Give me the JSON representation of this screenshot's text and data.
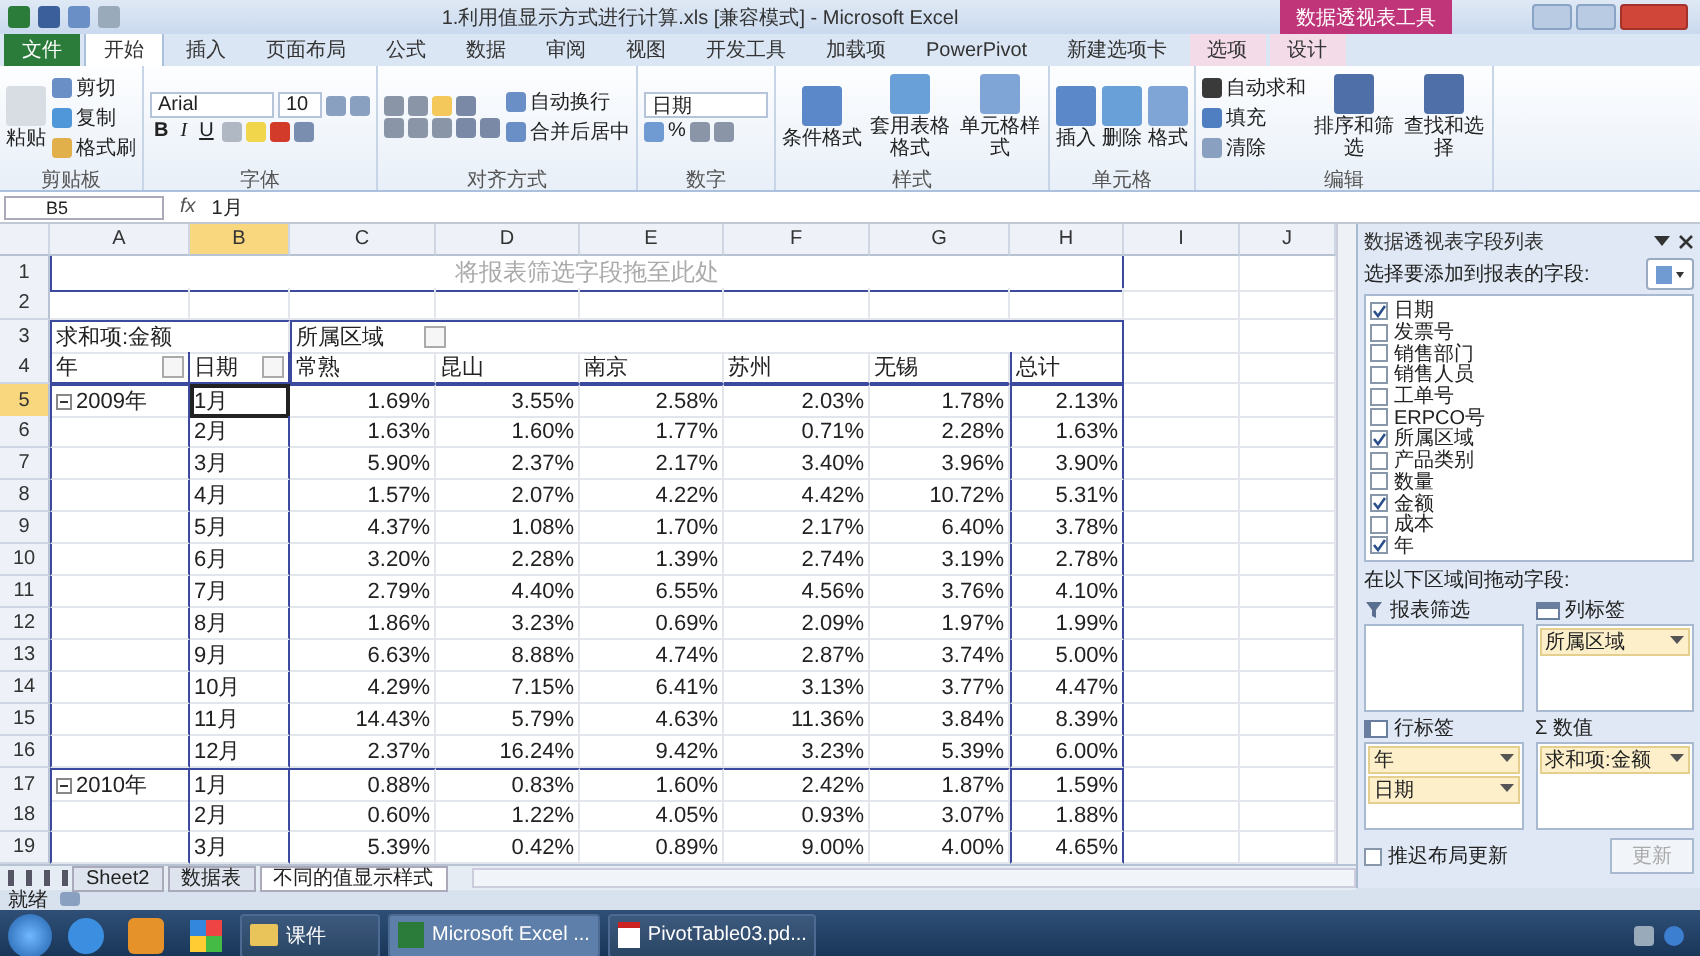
{
  "title_bar": {
    "title": "1.利用值显示方式进行计算.xls  [兼容模式] - Microsoft Excel",
    "context_label": "数据透视表工具"
  },
  "ribbon_tabs": [
    {
      "label": "文件",
      "kind": "file",
      "selected": false
    },
    {
      "label": "开始",
      "kind": "normal",
      "selected": true
    },
    {
      "label": "插入",
      "kind": "normal",
      "selected": false
    },
    {
      "label": "页面布局",
      "kind": "normal",
      "selected": false
    },
    {
      "label": "公式",
      "kind": "normal",
      "selected": false
    },
    {
      "label": "数据",
      "kind": "normal",
      "selected": false
    },
    {
      "label": "审阅",
      "kind": "normal",
      "selected": false
    },
    {
      "label": "视图",
      "kind": "normal",
      "selected": false
    },
    {
      "label": "开发工具",
      "kind": "normal",
      "selected": false
    },
    {
      "label": "加载项",
      "kind": "normal",
      "selected": false
    },
    {
      "label": "PowerPivot",
      "kind": "normal",
      "selected": false
    },
    {
      "label": "新建选项卡",
      "kind": "normal",
      "selected": false
    },
    {
      "label": "选项",
      "kind": "context",
      "selected": false
    },
    {
      "label": "设计",
      "kind": "context",
      "selected": false
    }
  ],
  "ribbon_groups": [
    {
      "label": "剪贴板",
      "kind": "clipboard",
      "big": "粘贴",
      "items": [
        "剪切",
        "复制",
        "格式刷"
      ]
    },
    {
      "label": "字体",
      "kind": "font",
      "font": "Arial",
      "size": "10",
      "style_buttons": [
        "B",
        "I",
        "U"
      ]
    },
    {
      "label": "对齐方式",
      "kind": "align",
      "items": [
        "自动换行",
        "合并后居中"
      ]
    },
    {
      "label": "数字",
      "kind": "number",
      "format": "日期",
      "items": [
        "%"
      ]
    },
    {
      "label": "样式",
      "kind": "large",
      "items": [
        "条件格式",
        "套用表格格式",
        "单元格样式"
      ]
    },
    {
      "label": "单元格",
      "kind": "large",
      "items": [
        "插入",
        "删除",
        "格式"
      ]
    },
    {
      "label": "编辑",
      "kind": "editing",
      "items": [
        "自动求和",
        "填充",
        "清除"
      ],
      "large": [
        "排序和筛选",
        "查找和选择"
      ]
    }
  ],
  "formula_bar": {
    "name_box": "B5",
    "fx": "fx",
    "value": "1月"
  },
  "sheet": {
    "columns": [
      {
        "label": "A",
        "selected": false
      },
      {
        "label": "B",
        "selected": true
      },
      {
        "label": "C",
        "selected": false
      },
      {
        "label": "D",
        "selected": false
      },
      {
        "label": "E",
        "selected": false
      },
      {
        "label": "F",
        "selected": false
      },
      {
        "label": "G",
        "selected": false
      },
      {
        "label": "H",
        "selected": false
      },
      {
        "label": "I",
        "selected": false
      },
      {
        "label": "J",
        "selected": false
      }
    ],
    "rows": [
      {
        "num": "1",
        "kind": "drop_zone",
        "selected": false,
        "text": "将报表筛选字段拖至此处"
      },
      {
        "num": "2",
        "kind": "blank",
        "selected": false
      },
      {
        "num": "3",
        "kind": "value_field",
        "selected": false,
        "label": "求和项:金额",
        "column_field": "所属区域"
      },
      {
        "num": "4",
        "kind": "field_headers",
        "selected": false,
        "row_fields": [
          "年",
          "日期"
        ],
        "columns": [
          "常熟",
          "昆山",
          "南京",
          "苏州",
          "无锡",
          "总计"
        ]
      },
      {
        "num": "5",
        "kind": "data",
        "selected": true,
        "year": "2009年",
        "month": "1月",
        "values": [
          "1.69%",
          "3.55%",
          "2.58%",
          "2.03%",
          "1.78%",
          "2.13%"
        ]
      },
      {
        "num": "6",
        "kind": "data",
        "selected": false,
        "month": "2月",
        "values": [
          "1.63%",
          "1.60%",
          "1.77%",
          "0.71%",
          "2.28%",
          "1.63%"
        ]
      },
      {
        "num": "7",
        "kind": "data",
        "selected": false,
        "month": "3月",
        "values": [
          "5.90%",
          "2.37%",
          "2.17%",
          "3.40%",
          "3.96%",
          "3.90%"
        ]
      },
      {
        "num": "8",
        "kind": "data",
        "selected": false,
        "month": "4月",
        "values": [
          "1.57%",
          "2.07%",
          "4.22%",
          "4.42%",
          "10.72%",
          "5.31%"
        ]
      },
      {
        "num": "9",
        "kind": "data",
        "selected": false,
        "month": "5月",
        "values": [
          "4.37%",
          "1.08%",
          "1.70%",
          "2.17%",
          "6.40%",
          "3.78%"
        ]
      },
      {
        "num": "10",
        "kind": "data",
        "selected": false,
        "month": "6月",
        "values": [
          "3.20%",
          "2.28%",
          "1.39%",
          "2.74%",
          "3.19%",
          "2.78%"
        ]
      },
      {
        "num": "11",
        "kind": "data",
        "selected": false,
        "month": "7月",
        "values": [
          "2.79%",
          "4.40%",
          "6.55%",
          "4.56%",
          "3.76%",
          "4.10%"
        ]
      },
      {
        "num": "12",
        "kind": "data",
        "selected": false,
        "month": "8月",
        "values": [
          "1.86%",
          "3.23%",
          "0.69%",
          "2.09%",
          "1.97%",
          "1.99%"
        ]
      },
      {
        "num": "13",
        "kind": "data",
        "selected": false,
        "month": "9月",
        "values": [
          "6.63%",
          "8.88%",
          "4.74%",
          "2.87%",
          "3.74%",
          "5.00%"
        ]
      },
      {
        "num": "14",
        "kind": "data",
        "selected": false,
        "month": "10月",
        "values": [
          "4.29%",
          "7.15%",
          "6.41%",
          "3.13%",
          "3.77%",
          "4.47%"
        ]
      },
      {
        "num": "15",
        "kind": "data",
        "selected": false,
        "month": "11月",
        "values": [
          "14.43%",
          "5.79%",
          "4.63%",
          "11.36%",
          "3.84%",
          "8.39%"
        ]
      },
      {
        "num": "16",
        "kind": "data",
        "selected": false,
        "month": "12月",
        "values": [
          "2.37%",
          "16.24%",
          "9.42%",
          "3.23%",
          "5.39%",
          "6.00%"
        ]
      },
      {
        "num": "17",
        "kind": "data",
        "selected": false,
        "year": "2010年",
        "month": "1月",
        "values": [
          "0.88%",
          "0.83%",
          "1.60%",
          "2.42%",
          "1.87%",
          "1.59%"
        ]
      },
      {
        "num": "18",
        "kind": "data",
        "selected": false,
        "month": "2月",
        "values": [
          "0.60%",
          "1.22%",
          "4.05%",
          "0.93%",
          "3.07%",
          "1.88%"
        ]
      },
      {
        "num": "19",
        "kind": "data",
        "selected": false,
        "month": "3月",
        "values": [
          "5.39%",
          "0.42%",
          "0.89%",
          "9.00%",
          "4.00%",
          "4.65%"
        ]
      }
    ]
  },
  "sheet_tabs": [
    {
      "label": "Sheet2",
      "selected": false
    },
    {
      "label": "数据表",
      "selected": false
    },
    {
      "label": "不同的值显示样式",
      "selected": true
    }
  ],
  "status_bar": {
    "text": "就绪"
  },
  "pivot_panel": {
    "title": "数据透视表字段列表",
    "choose_label": "选择要添加到报表的字段:",
    "fields": [
      {
        "label": "日期",
        "checked": true
      },
      {
        "label": "发票号",
        "checked": false
      },
      {
        "label": "销售部门",
        "checked": false
      },
      {
        "label": "销售人员",
        "checked": false
      },
      {
        "label": "工单号",
        "checked": false
      },
      {
        "label": "ERPCO号",
        "checked": false
      },
      {
        "label": "所属区域",
        "checked": true
      },
      {
        "label": "产品类别",
        "checked": false
      },
      {
        "label": "数量",
        "checked": false
      },
      {
        "label": "金额",
        "checked": true
      },
      {
        "label": "成本",
        "checked": false
      },
      {
        "label": "年",
        "checked": true
      }
    ],
    "drag_label": "在以下区域间拖动字段:",
    "areas": [
      {
        "label": "报表筛选",
        "kind": "filter"
      },
      {
        "label": "列标签",
        "kind": "columns",
        "items": [
          "所属区域"
        ]
      },
      {
        "label": "行标签",
        "kind": "rows",
        "items": [
          "年",
          "日期"
        ]
      },
      {
        "label": "数值",
        "kind": "values",
        "sigma": "Σ",
        "items": [
          "求和项:金额"
        ]
      }
    ],
    "defer": {
      "label": "推迟布局更新",
      "checked": false
    },
    "update_button": {
      "label": "更新",
      "disabled": true
    }
  },
  "taskbar": {
    "tasks": [
      {
        "label": "课件",
        "kind": "folder",
        "selected": false
      },
      {
        "label": "Microsoft Excel ...",
        "kind": "excel",
        "selected": true
      },
      {
        "label": "PivotTable03.pd...",
        "kind": "pdf",
        "selected": false
      }
    ]
  }
}
